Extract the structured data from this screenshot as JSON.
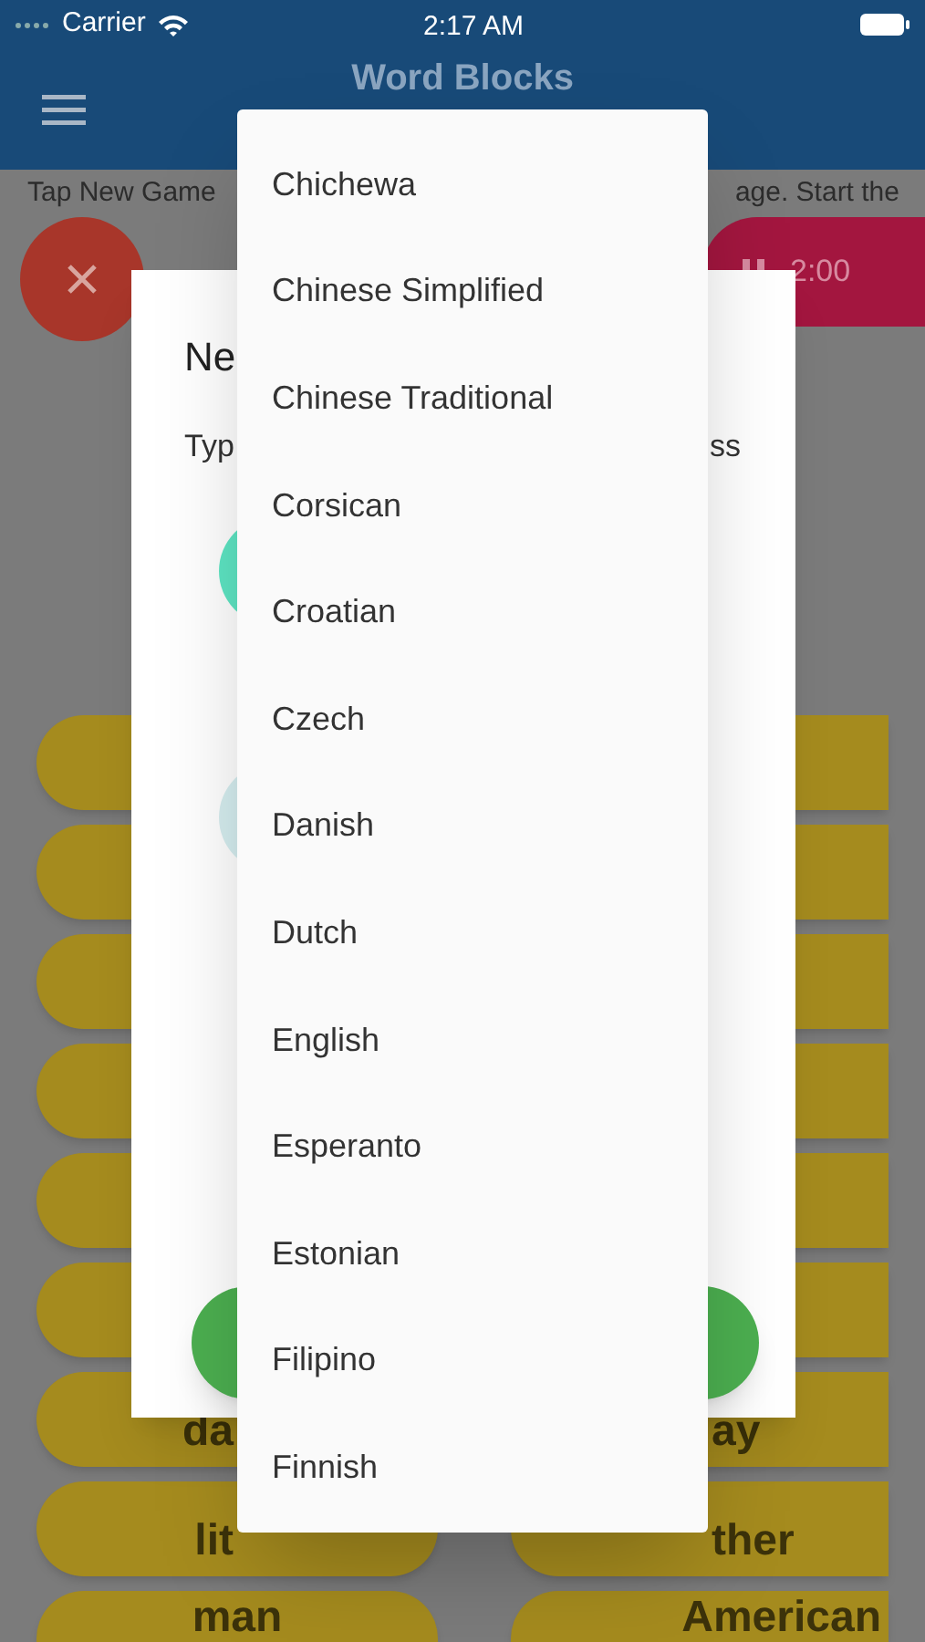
{
  "status_bar": {
    "carrier": "Carrier",
    "time": "2:17 AM"
  },
  "app_bar": {
    "title": "Word Blocks"
  },
  "hint": {
    "left": "Tap New Game",
    "right": "age. Start the"
  },
  "timer": {
    "time": "2:00"
  },
  "dialog": {
    "title": "Ne",
    "text_left": "Typ",
    "text_right": "ss"
  },
  "word_rows": [
    {
      "kind": "partial",
      "left": "da",
      "right": "ay"
    },
    {
      "kind": "partial",
      "left": "lit",
      "right": "ther"
    },
    {
      "kind": "full",
      "left": "man",
      "right": "American"
    }
  ],
  "language_menu": {
    "items": [
      "Chichewa",
      "Chinese Simplified",
      "Chinese Traditional",
      "Corsican",
      "Croatian",
      "Czech",
      "Danish",
      "Dutch",
      "English",
      "Esperanto",
      "Estonian",
      "Filipino",
      "Finnish"
    ]
  }
}
